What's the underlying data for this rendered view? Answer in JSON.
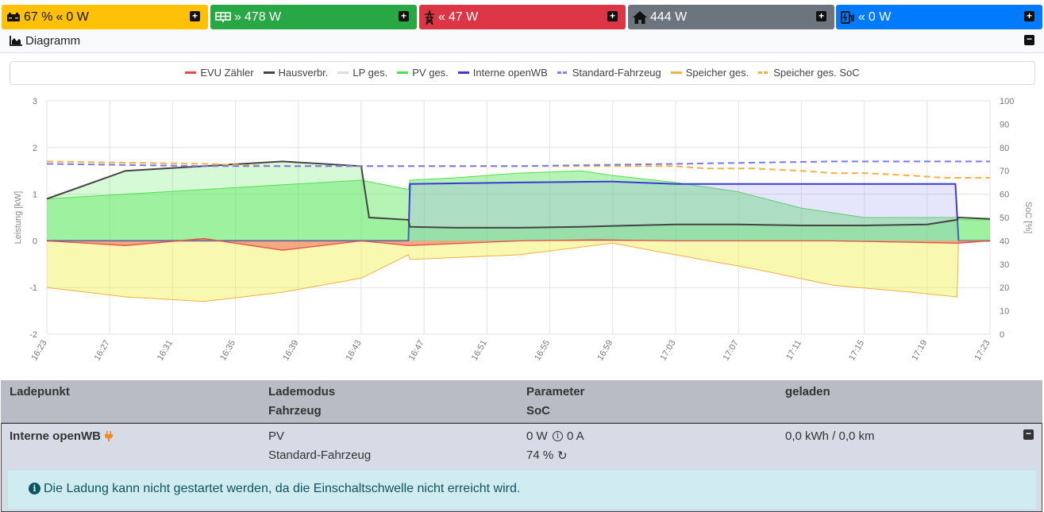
{
  "status_tiles": {
    "battery": {
      "soc": "67 %",
      "power": "0 W",
      "color": "#ffc107"
    },
    "pv": {
      "power": "478 W",
      "color": "#28a745"
    },
    "grid": {
      "power": "47 W",
      "color": "#dc3545"
    },
    "house": {
      "power": "444 W",
      "color": "#6c757d"
    },
    "wallbox": {
      "power": "0 W",
      "color": "#007bff"
    }
  },
  "chart_panel": {
    "title": "Diagramm"
  },
  "legend": [
    {
      "label": "EVU Zähler",
      "color": "#e94b4b",
      "dashed": false
    },
    {
      "label": "Hausverbr.",
      "color": "#444444",
      "dashed": false
    },
    {
      "label": "LP ges.",
      "color": "#dddddd",
      "dashed": false
    },
    {
      "label": "PV ges.",
      "color": "#4ee04e",
      "dashed": false
    },
    {
      "label": "Interne openWB",
      "color": "#3a3ad8",
      "dashed": false
    },
    {
      "label": "Standard-Fahrzeug",
      "color": "#8080f0",
      "dashed": true
    },
    {
      "label": "Speicher ges.",
      "color": "#f5b041",
      "dashed": false
    },
    {
      "label": "Speicher ges. SoC",
      "color": "#f5b041",
      "dashed": true
    }
  ],
  "chart_data": {
    "type": "line",
    "ylabel": "Leistung [kW]",
    "y2label": "SoC [%]",
    "ylim": [
      -2,
      3
    ],
    "y2lim": [
      0,
      100
    ],
    "y_ticks": [
      "3",
      "2",
      "1",
      "0",
      "-1",
      "-2"
    ],
    "y2_ticks": [
      "100",
      "90",
      "80",
      "70",
      "60",
      "50",
      "40",
      "30",
      "20",
      "10",
      "0"
    ],
    "x_ticks": [
      "16:23",
      "16:27",
      "16:31",
      "16:35",
      "16:39",
      "16:43",
      "16:47",
      "16:51",
      "16:55",
      "16:59",
      "17:03",
      "17:07",
      "17:11",
      "17:15",
      "17:19",
      "17:23"
    ],
    "x_range_minutes": [
      0,
      60
    ],
    "series": [
      {
        "name": "PV ges.",
        "x": [
          0,
          5,
          10,
          15,
          20,
          23,
          23.1,
          26,
          30,
          34,
          36,
          40,
          44,
          48,
          52,
          56,
          57.9,
          58,
          60
        ],
        "values": [
          0.9,
          1.0,
          1.1,
          1.2,
          1.3,
          1.1,
          1.3,
          1.35,
          1.45,
          1.5,
          1.4,
          1.25,
          1.05,
          0.7,
          0.5,
          0.5,
          0.5,
          0.45,
          0.45
        ]
      },
      {
        "name": "Hausverbr.",
        "x": [
          0,
          5,
          10,
          15,
          20,
          20.5,
          23,
          23.1,
          26,
          30,
          34,
          36,
          40,
          44,
          48,
          52,
          56,
          57.9,
          58,
          60
        ],
        "values": [
          0.9,
          1.5,
          1.6,
          1.7,
          1.6,
          0.5,
          0.45,
          0.3,
          0.28,
          0.28,
          0.3,
          0.32,
          0.35,
          0.35,
          0.33,
          0.33,
          0.35,
          0.45,
          0.5,
          0.47
        ]
      },
      {
        "name": "Interne openWB",
        "x": [
          0,
          23,
          23.1,
          30,
          36,
          40,
          50,
          57.8,
          58,
          60
        ],
        "values": [
          0,
          0,
          1.22,
          1.25,
          1.27,
          1.22,
          1.22,
          1.22,
          0,
          0
        ]
      },
      {
        "name": "EVU Zähler",
        "x": [
          0,
          5,
          10,
          15,
          20,
          23,
          30,
          35,
          40,
          50,
          58,
          60
        ],
        "values": [
          0,
          -0.1,
          0.05,
          -0.2,
          0,
          -0.1,
          0,
          0.02,
          0,
          0,
          -0.05,
          0
        ]
      },
      {
        "name": "Speicher ges.",
        "x": [
          0,
          5,
          10,
          15,
          20,
          23,
          23.1,
          30,
          36,
          40,
          45,
          50,
          55,
          57.9,
          58,
          60
        ],
        "values": [
          -1.0,
          -1.2,
          -1.3,
          -1.1,
          -0.8,
          -0.3,
          -0.4,
          -0.3,
          -0.05,
          -0.3,
          -0.6,
          -0.95,
          -1.1,
          -1.2,
          0,
          0
        ]
      },
      {
        "name": "Speicher ges. SoC",
        "x": [
          0,
          10,
          15,
          20,
          30,
          35,
          40,
          42,
          45,
          48,
          50,
          52,
          55,
          57,
          60
        ],
        "values": [
          74,
          73,
          72,
          72,
          72,
          72,
          72,
          71,
          71,
          70,
          69,
          69,
          68,
          67,
          67
        ]
      },
      {
        "name": "Standard-Fahrzeug",
        "x": [
          0,
          10,
          20,
          30,
          40,
          50,
          58,
          60
        ],
        "values": [
          73,
          72,
          72,
          72,
          73,
          74,
          74,
          74
        ]
      }
    ]
  },
  "table": {
    "headers": {
      "col1": "Ladepunkt",
      "col2a": "Lademodus",
      "col2b": "Fahrzeug",
      "col3a": "Parameter",
      "col3b": "SoC",
      "col4": "geladen"
    },
    "row": {
      "name": "Interne openWB",
      "mode": "PV",
      "vehicle": "Standard-Fahrzeug",
      "power": "0 W",
      "current": "0 A",
      "soc": "74 %",
      "charged": "0,0 kWh / 0,0 km"
    },
    "alert": "Die Ladung kann nicht gestartet werden, da die Einschaltschwelle nicht erreicht wird."
  }
}
